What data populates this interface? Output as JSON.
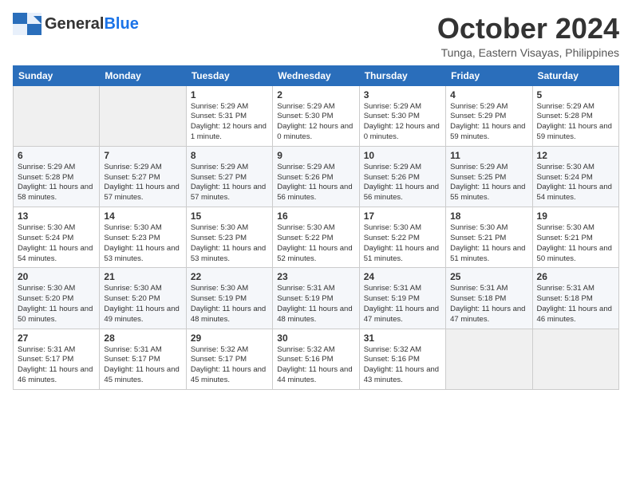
{
  "logo": {
    "general": "General",
    "blue": "Blue"
  },
  "header": {
    "month": "October 2024",
    "location": "Tunga, Eastern Visayas, Philippines"
  },
  "weekdays": [
    "Sunday",
    "Monday",
    "Tuesday",
    "Wednesday",
    "Thursday",
    "Friday",
    "Saturday"
  ],
  "weeks": [
    [
      {
        "day": "",
        "empty": true
      },
      {
        "day": "",
        "empty": true
      },
      {
        "day": "1",
        "sunrise": "5:29 AM",
        "sunset": "5:31 PM",
        "daylight": "12 hours and 1 minute."
      },
      {
        "day": "2",
        "sunrise": "5:29 AM",
        "sunset": "5:30 PM",
        "daylight": "12 hours and 0 minutes."
      },
      {
        "day": "3",
        "sunrise": "5:29 AM",
        "sunset": "5:30 PM",
        "daylight": "12 hours and 0 minutes."
      },
      {
        "day": "4",
        "sunrise": "5:29 AM",
        "sunset": "5:29 PM",
        "daylight": "11 hours and 59 minutes."
      },
      {
        "day": "5",
        "sunrise": "5:29 AM",
        "sunset": "5:28 PM",
        "daylight": "11 hours and 59 minutes."
      }
    ],
    [
      {
        "day": "6",
        "sunrise": "5:29 AM",
        "sunset": "5:28 PM",
        "daylight": "11 hours and 58 minutes."
      },
      {
        "day": "7",
        "sunrise": "5:29 AM",
        "sunset": "5:27 PM",
        "daylight": "11 hours and 57 minutes."
      },
      {
        "day": "8",
        "sunrise": "5:29 AM",
        "sunset": "5:27 PM",
        "daylight": "11 hours and 57 minutes."
      },
      {
        "day": "9",
        "sunrise": "5:29 AM",
        "sunset": "5:26 PM",
        "daylight": "11 hours and 56 minutes."
      },
      {
        "day": "10",
        "sunrise": "5:29 AM",
        "sunset": "5:26 PM",
        "daylight": "11 hours and 56 minutes."
      },
      {
        "day": "11",
        "sunrise": "5:29 AM",
        "sunset": "5:25 PM",
        "daylight": "11 hours and 55 minutes."
      },
      {
        "day": "12",
        "sunrise": "5:30 AM",
        "sunset": "5:24 PM",
        "daylight": "11 hours and 54 minutes."
      }
    ],
    [
      {
        "day": "13",
        "sunrise": "5:30 AM",
        "sunset": "5:24 PM",
        "daylight": "11 hours and 54 minutes."
      },
      {
        "day": "14",
        "sunrise": "5:30 AM",
        "sunset": "5:23 PM",
        "daylight": "11 hours and 53 minutes."
      },
      {
        "day": "15",
        "sunrise": "5:30 AM",
        "sunset": "5:23 PM",
        "daylight": "11 hours and 53 minutes."
      },
      {
        "day": "16",
        "sunrise": "5:30 AM",
        "sunset": "5:22 PM",
        "daylight": "11 hours and 52 minutes."
      },
      {
        "day": "17",
        "sunrise": "5:30 AM",
        "sunset": "5:22 PM",
        "daylight": "11 hours and 51 minutes."
      },
      {
        "day": "18",
        "sunrise": "5:30 AM",
        "sunset": "5:21 PM",
        "daylight": "11 hours and 51 minutes."
      },
      {
        "day": "19",
        "sunrise": "5:30 AM",
        "sunset": "5:21 PM",
        "daylight": "11 hours and 50 minutes."
      }
    ],
    [
      {
        "day": "20",
        "sunrise": "5:30 AM",
        "sunset": "5:20 PM",
        "daylight": "11 hours and 50 minutes."
      },
      {
        "day": "21",
        "sunrise": "5:30 AM",
        "sunset": "5:20 PM",
        "daylight": "11 hours and 49 minutes."
      },
      {
        "day": "22",
        "sunrise": "5:30 AM",
        "sunset": "5:19 PM",
        "daylight": "11 hours and 48 minutes."
      },
      {
        "day": "23",
        "sunrise": "5:31 AM",
        "sunset": "5:19 PM",
        "daylight": "11 hours and 48 minutes."
      },
      {
        "day": "24",
        "sunrise": "5:31 AM",
        "sunset": "5:19 PM",
        "daylight": "11 hours and 47 minutes."
      },
      {
        "day": "25",
        "sunrise": "5:31 AM",
        "sunset": "5:18 PM",
        "daylight": "11 hours and 47 minutes."
      },
      {
        "day": "26",
        "sunrise": "5:31 AM",
        "sunset": "5:18 PM",
        "daylight": "11 hours and 46 minutes."
      }
    ],
    [
      {
        "day": "27",
        "sunrise": "5:31 AM",
        "sunset": "5:17 PM",
        "daylight": "11 hours and 46 minutes."
      },
      {
        "day": "28",
        "sunrise": "5:31 AM",
        "sunset": "5:17 PM",
        "daylight": "11 hours and 45 minutes."
      },
      {
        "day": "29",
        "sunrise": "5:32 AM",
        "sunset": "5:17 PM",
        "daylight": "11 hours and 45 minutes."
      },
      {
        "day": "30",
        "sunrise": "5:32 AM",
        "sunset": "5:16 PM",
        "daylight": "11 hours and 44 minutes."
      },
      {
        "day": "31",
        "sunrise": "5:32 AM",
        "sunset": "5:16 PM",
        "daylight": "11 hours and 43 minutes."
      },
      {
        "day": "",
        "empty": true
      },
      {
        "day": "",
        "empty": true
      }
    ]
  ]
}
